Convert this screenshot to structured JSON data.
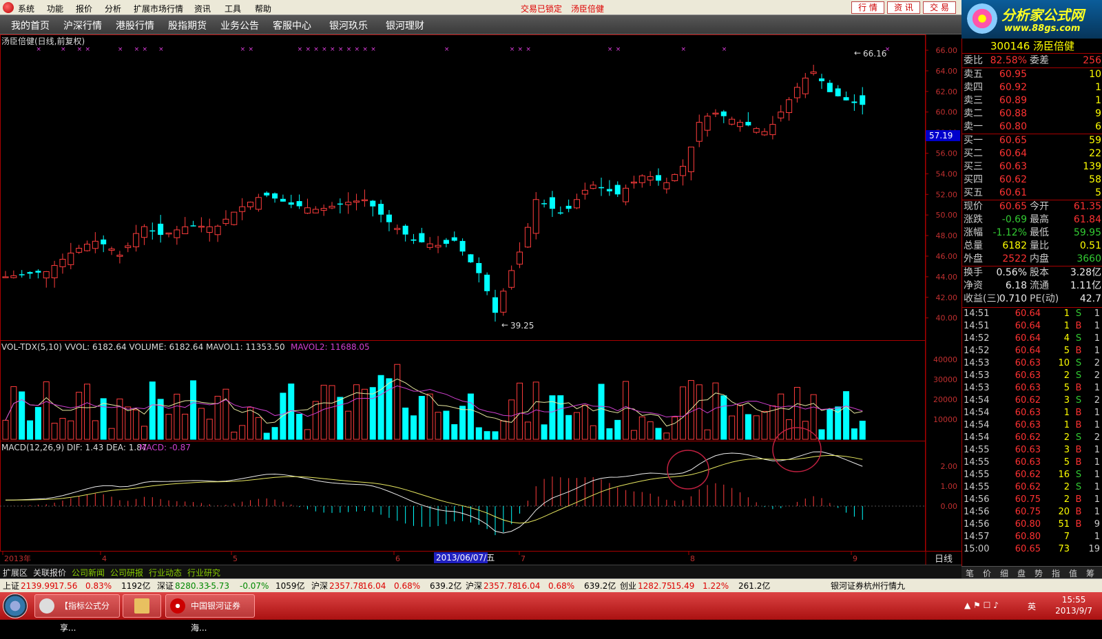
{
  "menubar": {
    "items": [
      "系统",
      "功能",
      "报价",
      "分析",
      "扩展市场行情",
      "资讯",
      "工具",
      "帮助"
    ],
    "locked_text": "交易已锁定",
    "stock_text": "汤臣倍健",
    "buttons": [
      "行 情",
      "资 讯",
      "交 易"
    ]
  },
  "navbar": {
    "items": [
      "我的首页",
      "沪深行情",
      "港股行情",
      "股指期货",
      "业务公告",
      "客服中心",
      "银河玖乐",
      "银河理财"
    ]
  },
  "brand": {
    "title": "分析家公式网",
    "url": "www.88gs.com"
  },
  "chart": {
    "title": "汤臣倍健(日线,前复权)",
    "price_axis": [
      "66.00",
      "64.00",
      "62.00",
      "60.00",
      "58.00",
      "56.00",
      "54.00",
      "52.00",
      "50.00",
      "48.00",
      "46.00",
      "44.00",
      "42.00",
      "40.00"
    ],
    "cursor_price": "57.19",
    "high_label": "66.16",
    "low_label": "39.25",
    "vol_header": "VOL-TDX(5,10)  VVOL: 6182.64   VOLUME: 6182.64   MAVOL1: 11353.50",
    "vol_mavol2": "MAVOL2: 11688.05",
    "vol_axis": [
      "40000",
      "30000",
      "20000",
      "10000"
    ],
    "macd_header": "MACD(12,26,9)  DIF: 1.43  DEA: 1.87",
    "macd_value": "MACD: -0.87",
    "macd_axis": [
      "2.00",
      "1.00",
      "0.00"
    ],
    "x_labels": [
      "2013年",
      "4",
      "5",
      "6",
      "7",
      "8",
      "9"
    ],
    "cursor_date": "2013/06/07/五",
    "period": "日线"
  },
  "quote": {
    "code_name": "300146 汤臣倍健",
    "ratio_label": "委比",
    "ratio_value": "82.58%",
    "diff_label": "委差",
    "diff_value": "256",
    "sells": [
      {
        "label": "卖五",
        "price": "60.95",
        "vol": "10"
      },
      {
        "label": "卖四",
        "price": "60.92",
        "vol": "1"
      },
      {
        "label": "卖三",
        "price": "60.89",
        "vol": "1"
      },
      {
        "label": "卖二",
        "price": "60.88",
        "vol": "9"
      },
      {
        "label": "卖一",
        "price": "60.80",
        "vol": "6"
      }
    ],
    "buys": [
      {
        "label": "买一",
        "price": "60.65",
        "vol": "59"
      },
      {
        "label": "买二",
        "price": "60.64",
        "vol": "22"
      },
      {
        "label": "买三",
        "price": "60.63",
        "vol": "139"
      },
      {
        "label": "买四",
        "price": "60.62",
        "vol": "58"
      },
      {
        "label": "买五",
        "price": "60.61",
        "vol": "5"
      }
    ],
    "stats": [
      {
        "l": "现价",
        "v": "60.65",
        "vc": "red",
        "l2": "今开",
        "v2": "61.35",
        "v2c": "red"
      },
      {
        "l": "涨跌",
        "v": "-0.69",
        "vc": "green",
        "l2": "最高",
        "v2": "61.84",
        "v2c": "red"
      },
      {
        "l": "涨幅",
        "v": "-1.12%",
        "vc": "green",
        "l2": "最低",
        "v2": "59.95",
        "v2c": "green"
      },
      {
        "l": "总量",
        "v": "6182",
        "vc": "yellow",
        "l2": "量比",
        "v2": "0.51",
        "v2c": "yellow"
      },
      {
        "l": "外盘",
        "v": "2522",
        "vc": "red",
        "l2": "内盘",
        "v2": "3660",
        "v2c": "green"
      }
    ],
    "stats2": [
      {
        "l": "换手",
        "v": "0.56%",
        "vc": "white",
        "l2": "股本",
        "v2": "3.28亿",
        "v2c": "white"
      },
      {
        "l": "净资",
        "v": "6.18",
        "vc": "white",
        "l2": "流通",
        "v2": "1.11亿",
        "v2c": "white"
      },
      {
        "l": "收益(三)",
        "v": "0.710",
        "vc": "white",
        "l2": "PE(动)",
        "v2": "42.7",
        "v2c": "white"
      }
    ],
    "ticks": [
      {
        "t": "14:51",
        "p": "60.64",
        "pc": "red",
        "v": "1",
        "bs": "S",
        "c": "1"
      },
      {
        "t": "14:51",
        "p": "60.64",
        "pc": "red",
        "v": "1",
        "bs": "B",
        "c": "1"
      },
      {
        "t": "14:52",
        "p": "60.64",
        "pc": "red",
        "v": "4",
        "bs": "S",
        "c": "1"
      },
      {
        "t": "14:52",
        "p": "60.64",
        "pc": "red",
        "v": "5",
        "bs": "B",
        "c": "1"
      },
      {
        "t": "14:53",
        "p": "60.63",
        "pc": "red",
        "v": "10",
        "bs": "S",
        "c": "2"
      },
      {
        "t": "14:53",
        "p": "60.63",
        "pc": "red",
        "v": "2",
        "bs": "S",
        "c": "2"
      },
      {
        "t": "14:53",
        "p": "60.63",
        "pc": "red",
        "v": "5",
        "bs": "B",
        "c": "1"
      },
      {
        "t": "14:54",
        "p": "60.62",
        "pc": "red",
        "v": "3",
        "bs": "S",
        "c": "2"
      },
      {
        "t": "14:54",
        "p": "60.63",
        "pc": "red",
        "v": "1",
        "bs": "B",
        "c": "1"
      },
      {
        "t": "14:54",
        "p": "60.63",
        "pc": "red",
        "v": "1",
        "bs": "B",
        "c": "1"
      },
      {
        "t": "14:54",
        "p": "60.62",
        "pc": "red",
        "v": "2",
        "bs": "S",
        "c": "2"
      },
      {
        "t": "14:55",
        "p": "60.63",
        "pc": "red",
        "v": "3",
        "bs": "B",
        "c": "1"
      },
      {
        "t": "14:55",
        "p": "60.63",
        "pc": "red",
        "v": "5",
        "bs": "B",
        "c": "1"
      },
      {
        "t": "14:55",
        "p": "60.62",
        "pc": "red",
        "v": "16",
        "bs": "S",
        "c": "1"
      },
      {
        "t": "14:55",
        "p": "60.62",
        "pc": "red",
        "v": "2",
        "bs": "S",
        "c": "1"
      },
      {
        "t": "14:56",
        "p": "60.75",
        "pc": "red",
        "v": "2",
        "bs": "B",
        "c": "1"
      },
      {
        "t": "14:56",
        "p": "60.75",
        "pc": "red",
        "v": "20",
        "bs": "B",
        "c": "1"
      },
      {
        "t": "14:56",
        "p": "60.80",
        "pc": "red",
        "v": "51",
        "bs": "B",
        "c": "9"
      },
      {
        "t": "14:57",
        "p": "60.80",
        "pc": "red",
        "v": "7",
        "bs": "",
        "c": "1"
      },
      {
        "t": "15:00",
        "p": "60.65",
        "pc": "red",
        "v": "73",
        "bs": "",
        "c": "19"
      }
    ],
    "tabs": [
      "笔",
      "价",
      "细",
      "盘",
      "势",
      "指",
      "值",
      "筹"
    ]
  },
  "tabbar": {
    "items": [
      "扩展区",
      "关联报价",
      "公司新闻",
      "公司研报",
      "行业动态",
      "行业研究"
    ]
  },
  "indexbar": {
    "items": [
      {
        "name": "上证",
        "val": "2139.99",
        "chg": "17.56",
        "pct": "0.83%",
        "amt": "1192亿",
        "dir": "red"
      },
      {
        "name": "深证",
        "val": "8280.33",
        "chg": "-5.73",
        "pct": "-0.07%",
        "amt": "1059亿",
        "dir": "green"
      },
      {
        "name": "沪深",
        "val": "2357.78",
        "chg": "16.04",
        "pct": "0.68%",
        "amt": "639.2亿",
        "dir": "red"
      },
      {
        "name": "沪深",
        "val": "2357.78",
        "chg": "16.04",
        "pct": "0.68%",
        "amt": "639.2亿",
        "dir": "red"
      },
      {
        "name": "创业",
        "val": "1282.75",
        "chg": "15.49",
        "pct": "1.22%",
        "amt": "261.2亿",
        "dir": "red"
      }
    ],
    "broker": "银河证券杭州行情九"
  },
  "taskbar": {
    "tasks": [
      "【指标公式分享...",
      "",
      "中国银河证券海..."
    ],
    "lang": "英",
    "time": "15:55",
    "date": "2013/9/7"
  }
}
